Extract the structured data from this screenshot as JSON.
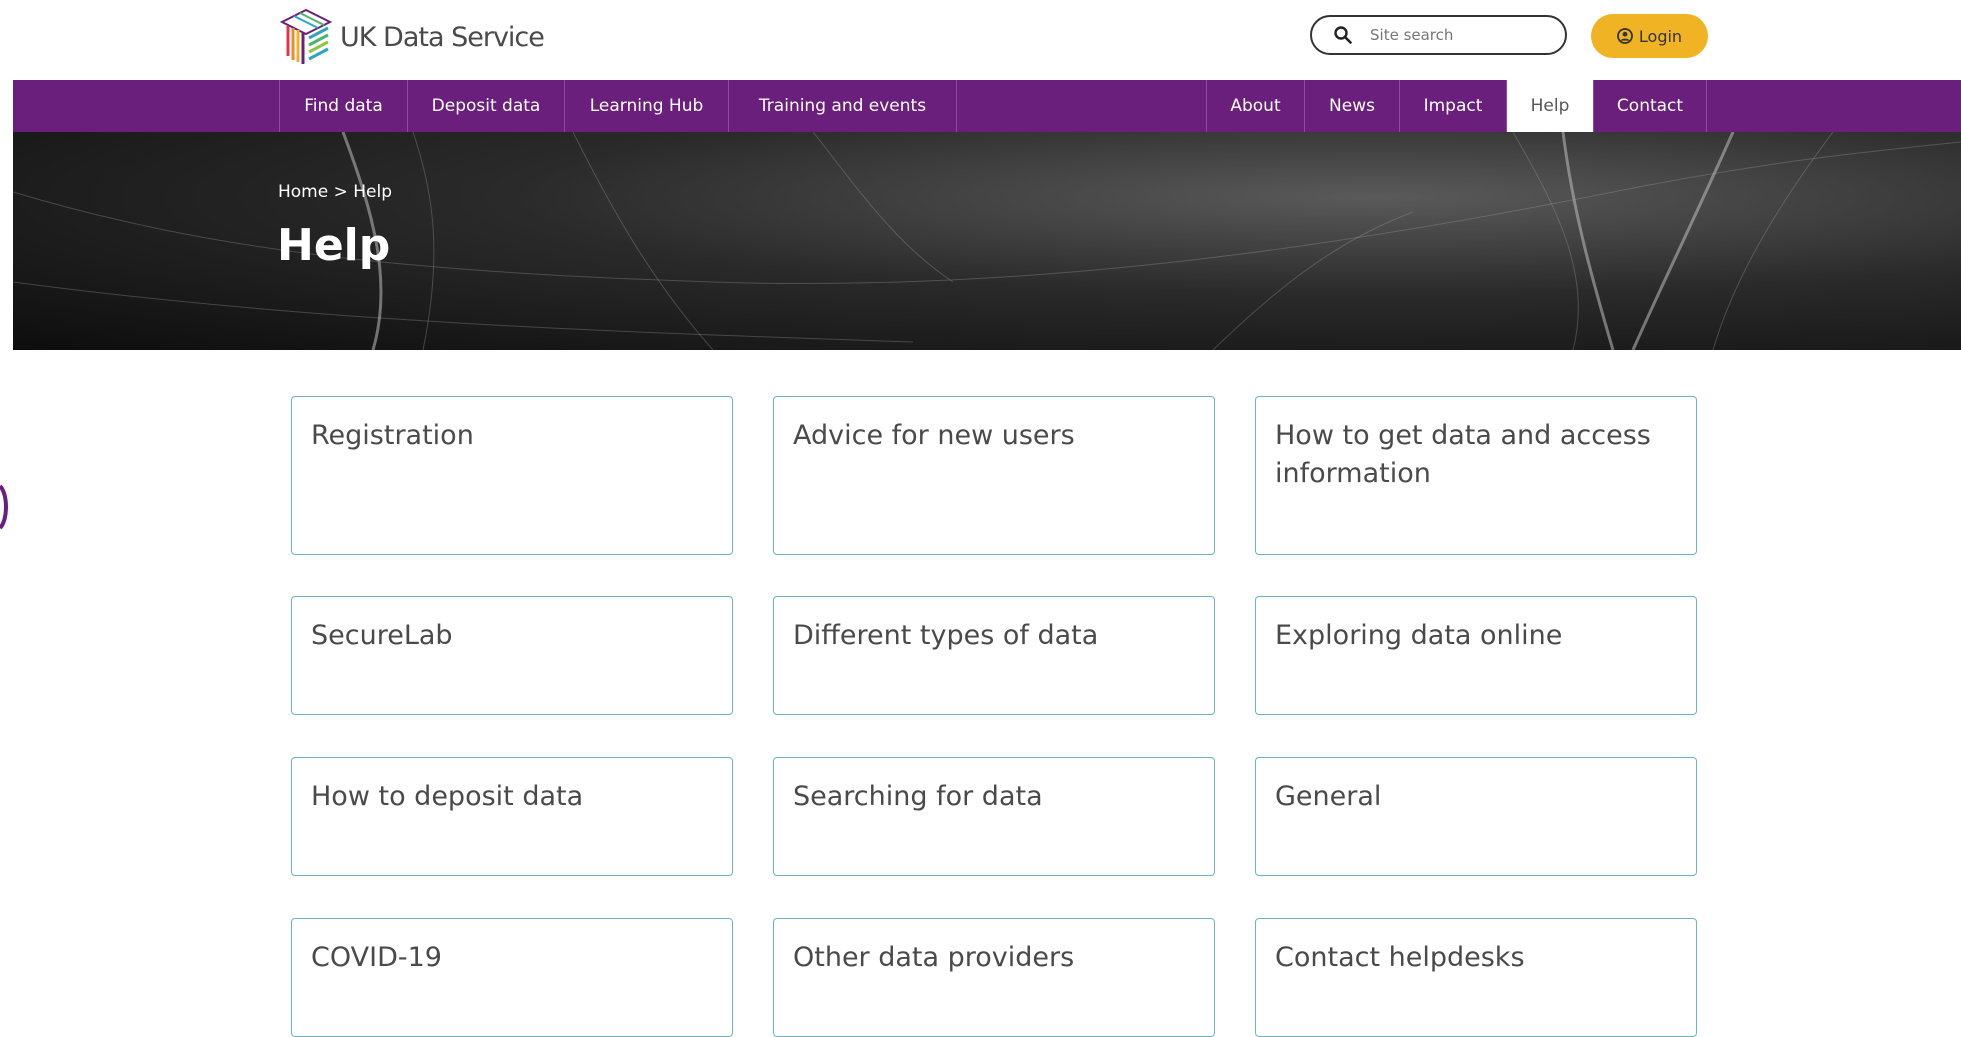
{
  "header": {
    "logo_text": "UK Data Service",
    "search_placeholder": "Site search",
    "login_label": "Login"
  },
  "nav": {
    "left": [
      "Find data",
      "Deposit data",
      "Learning Hub",
      "Training and events"
    ],
    "right": [
      "About",
      "News",
      "Impact",
      "Help",
      "Contact"
    ],
    "active": "Help"
  },
  "breadcrumb": {
    "home": "Home",
    "separator": ">",
    "current": "Help"
  },
  "page_title": "Help",
  "cards": [
    "Registration",
    "Advice for new users",
    "How to get data and access information",
    "SecureLab",
    "Different types of data",
    "Exploring data online",
    "How to deposit data",
    "Searching for data",
    "General",
    "COVID-19",
    "Other data providers",
    "Contact helpdesks"
  ],
  "colors": {
    "nav_bg": "#6b1f7c",
    "login_bg": "#f0b323",
    "card_border": "#6db3c4"
  }
}
